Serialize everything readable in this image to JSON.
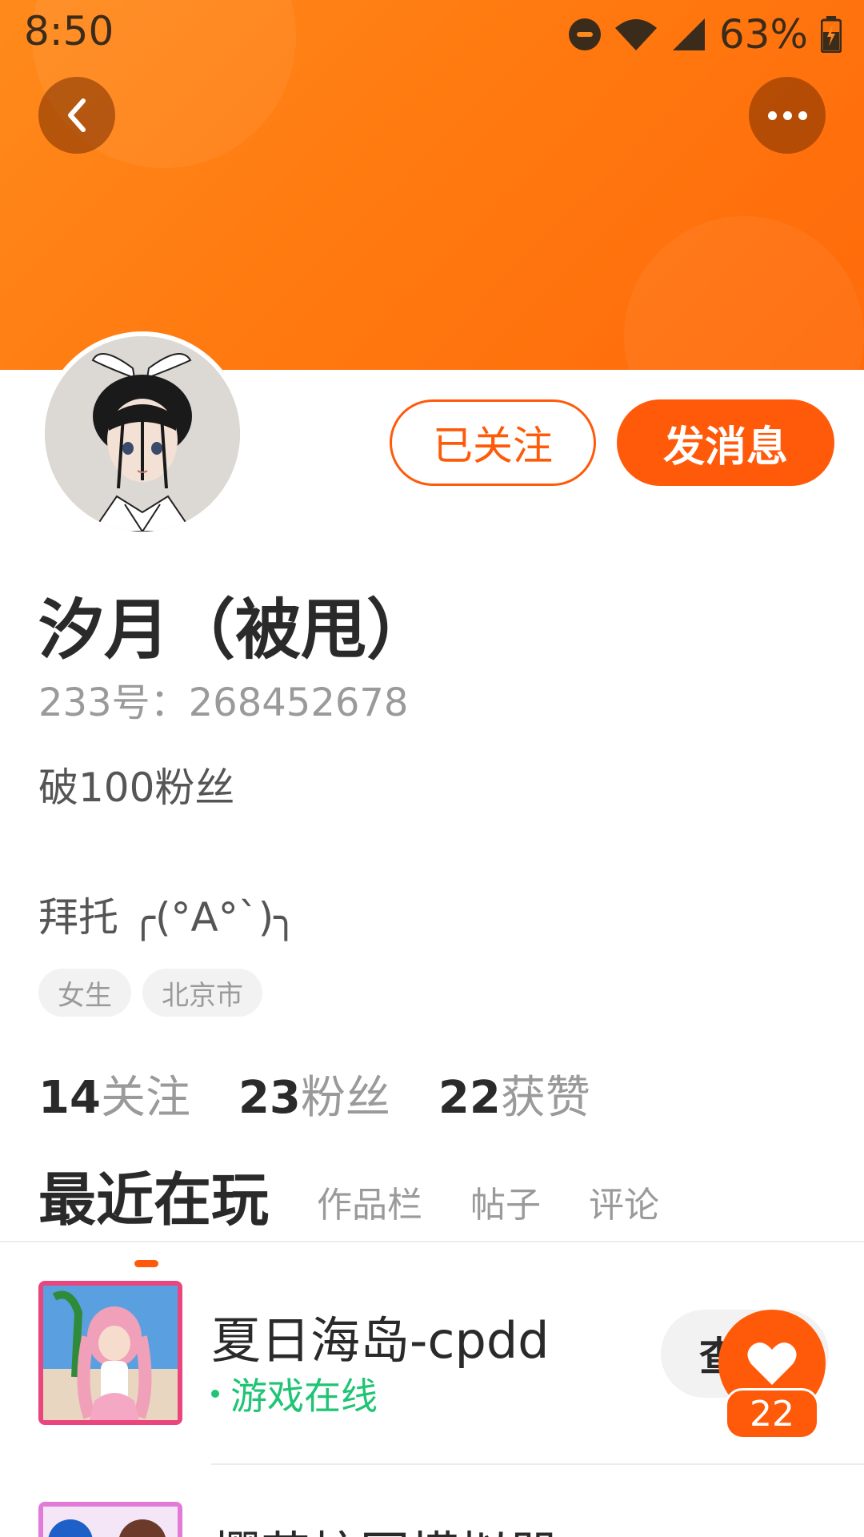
{
  "status_bar": {
    "time": "8:50",
    "battery": "63%"
  },
  "header": {
    "back_icon": "chevron-left-icon",
    "more_icon": "more-horizontal-icon"
  },
  "profile": {
    "follow_label": "已关注",
    "message_label": "发消息",
    "name": "汐月（被甩）",
    "id_text": "233号：268452678",
    "bio_line1": "破100粉丝",
    "bio_line2": "拜托 ╭(°A°`)╮",
    "tags": [
      "女生",
      "北京市"
    ],
    "stats": [
      {
        "num": "14",
        "label": "关注"
      },
      {
        "num": "23",
        "label": "粉丝"
      },
      {
        "num": "22",
        "label": "获赞"
      }
    ]
  },
  "tabs": {
    "active": "最近在玩",
    "others": [
      "作品栏",
      "帖子",
      "评论"
    ]
  },
  "games": [
    {
      "title": "夏日海岛-cpdd",
      "status": "游戏在线",
      "action": "查看"
    },
    {
      "title": "樱花校园模拟器"
    }
  ],
  "like": {
    "count": "22"
  },
  "colors": {
    "accent": "#ff5a0a",
    "online": "#1fc474",
    "banner": "#ff7a10"
  }
}
